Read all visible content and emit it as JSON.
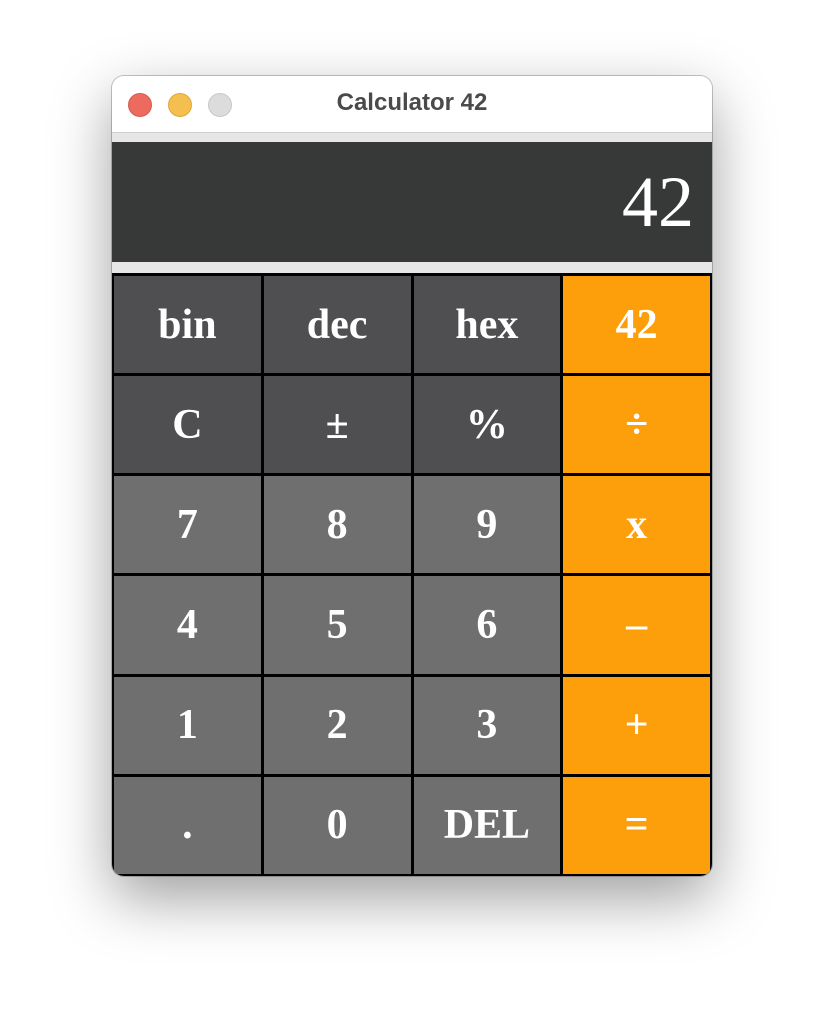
{
  "window": {
    "title": "Calculator 42"
  },
  "display": {
    "value": "42"
  },
  "colors": {
    "display_bg": "#373838",
    "function_key": "#4f4e50",
    "digit_key": "#6f6f6f",
    "operator_key": "#fd9e0b",
    "key_text": "#ffffff",
    "traffic_close": "#ed6a5e",
    "traffic_minimize": "#f5bf4f",
    "traffic_maximize": "#dcdcdc"
  },
  "keys": {
    "bin": "bin",
    "dec": "dec",
    "hex": "hex",
    "answer": "42",
    "clear": "C",
    "sign": "±",
    "percent": "%",
    "divide": "÷",
    "seven": "7",
    "eight": "8",
    "nine": "9",
    "multiply": "x",
    "four": "4",
    "five": "5",
    "six": "6",
    "subtract": "–",
    "one": "1",
    "two": "2",
    "three": "3",
    "add": "+",
    "decimal": ".",
    "zero": "0",
    "delete": "DEL",
    "equals": "="
  }
}
